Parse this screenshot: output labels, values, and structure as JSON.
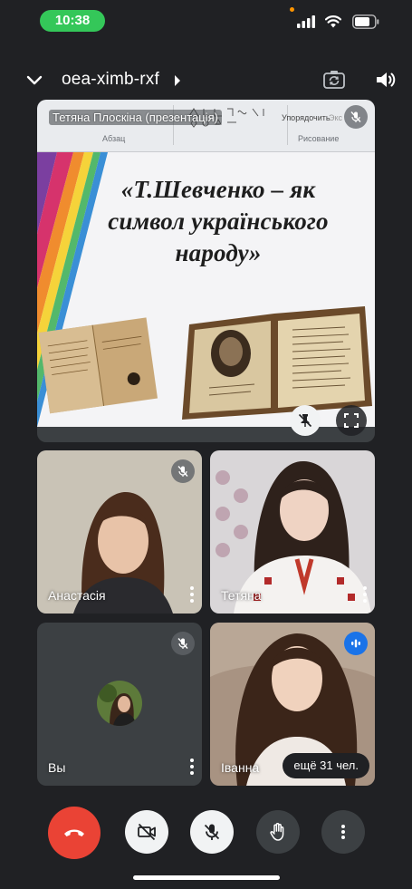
{
  "status_bar": {
    "time": "10:38",
    "icons": [
      "signal-icon",
      "wifi-icon",
      "battery-icon"
    ]
  },
  "header": {
    "meeting_code": "oea-ximb-rxf",
    "icons": [
      "chevron-down-icon",
      "switch-camera-icon",
      "speaker-icon"
    ]
  },
  "presentation": {
    "presenter_label": "Тетяна Плоскіна (презентація)",
    "ribbon": {
      "group_left": "Абзац",
      "group_right": "Рисование",
      "command": "Упорядочить",
      "command_faded": "Экс"
    },
    "slide_title_lines": [
      "«Т.Шевченко – як",
      "символ українського",
      "народу»"
    ]
  },
  "participants": [
    {
      "name": "Анастасія",
      "muted": true
    },
    {
      "name": "Тетяна",
      "muted": false
    },
    {
      "name": "Вы",
      "muted": true
    },
    {
      "name": "Іванна",
      "speaking": true
    }
  ],
  "more_participants": "ещё 31 чел.",
  "controls": [
    "hang-up-button",
    "camera-off-button",
    "mic-off-button",
    "raise-hand-button",
    "more-options-button"
  ],
  "colors": {
    "background": "#202124",
    "tile": "#3c4043",
    "hangup": "#ea4335",
    "speaking": "#1a73e8",
    "time_pill": "#34c759"
  }
}
